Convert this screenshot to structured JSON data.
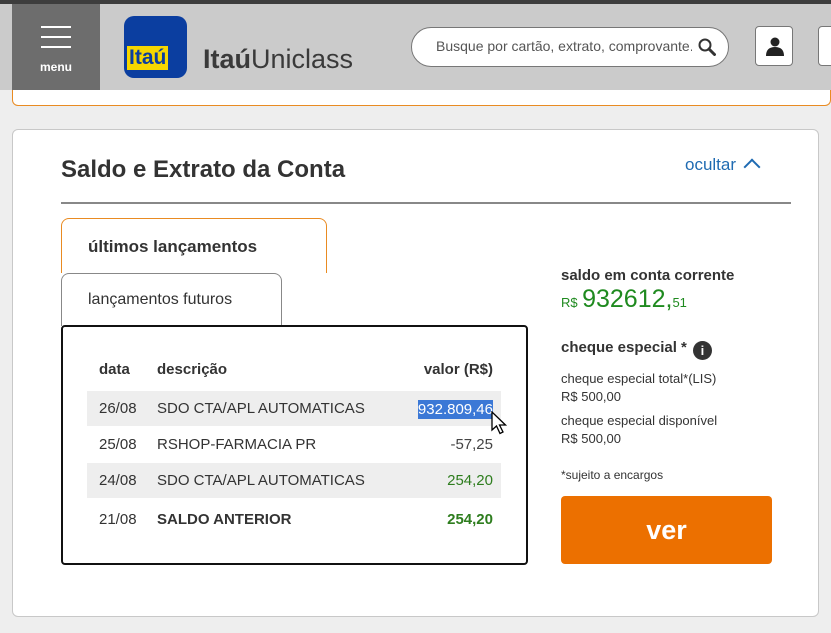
{
  "header": {
    "menu_label": "menu",
    "logo_text": "Itaú",
    "brand_bold": "Itaú",
    "brand_light": "Uniclass",
    "search_placeholder": "Busque por cartão, extrato, comprovante..."
  },
  "card": {
    "title": "Saldo e Extrato da Conta",
    "hide_link": "ocultar",
    "tabs": [
      {
        "label": "últimos lançamentos",
        "active": true
      },
      {
        "label": "lançamentos futuros",
        "active": false
      }
    ],
    "table": {
      "headers": {
        "date": "data",
        "desc": "descrição",
        "value": "valor (R$)"
      },
      "rows": [
        {
          "date": "26/08",
          "desc": "SDO CTA/APL AUTOMATICAS",
          "value": "932.809,46",
          "selected": true
        },
        {
          "date": "25/08",
          "desc": "RSHOP-FARMACIA PR",
          "value": "-57,25"
        },
        {
          "date": "24/08",
          "desc": "SDO CTA/APL AUTOMATICAS",
          "value": "254,20"
        },
        {
          "date": "21/08",
          "desc": "SALDO ANTERIOR",
          "value": "254,20"
        }
      ]
    },
    "balance": {
      "label": "saldo em conta corrente",
      "currency": "R$",
      "integer": "932612,",
      "cents": "51"
    },
    "overdraft": {
      "label": "cheque especial *",
      "info_icon": "i",
      "total_label": "cheque especial total*(LIS)",
      "total_value": "R$ 500,00",
      "available_label": "cheque especial disponível",
      "available_value": "R$ 500,00",
      "note": "*sujeito a encargos"
    },
    "ver_button": "ver"
  },
  "colors": {
    "accent": "#ec7000",
    "link": "#1f6bb2",
    "positive": "#1f8a1f",
    "brand_blue": "#0b3ea0",
    "brand_yellow": "#f6d700"
  }
}
